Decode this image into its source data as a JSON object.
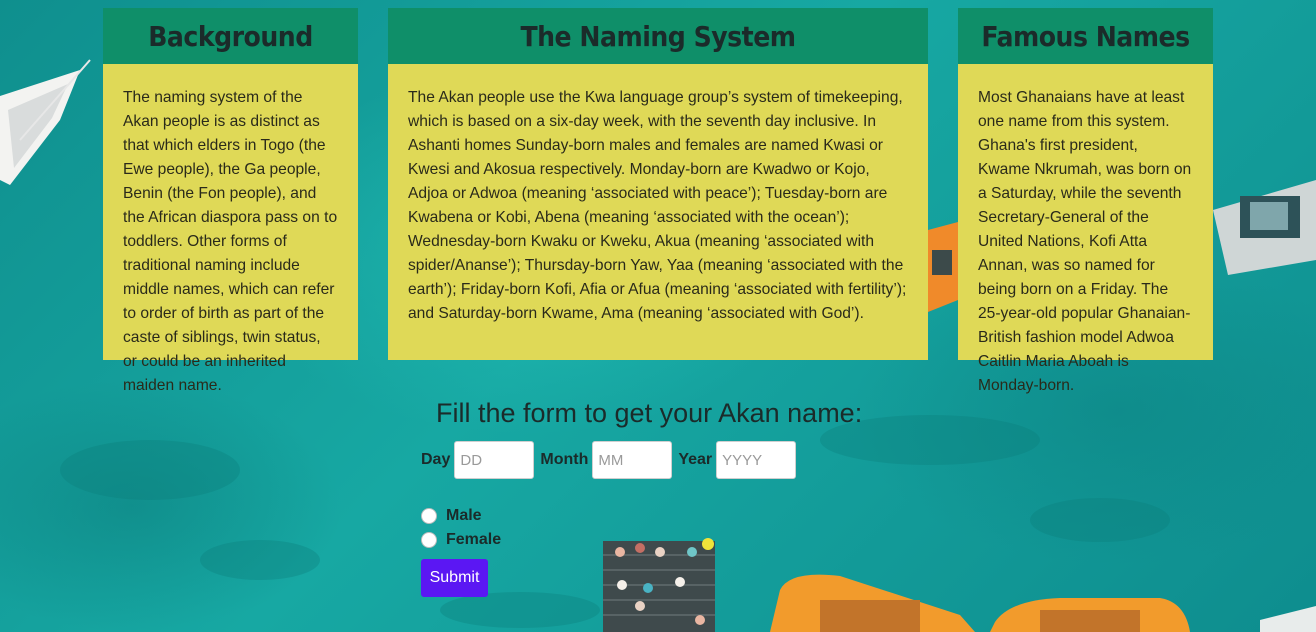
{
  "cards": [
    {
      "title": "Background",
      "body": "The naming system of the Akan people is as distinct as that which elders in Togo (the Ewe people), the Ga people, Benin (the Fon people), and the African diaspora pass on to toddlers. Other forms of traditional naming include middle names, which can refer to order of birth as part of the caste of siblings, twin status, or could be an inherited maiden name."
    },
    {
      "title": "The Naming System",
      "body": "The Akan people use the Kwa language group’s system of timekeeping, which is based on a six-day week, with the seventh day inclusive. In Ashanti homes Sunday-born males and females are named Kwasi or Kwesi and Akosua respectively. Monday-born are Kwadwo or Kojo, Adjoa or Adwoa (meaning ‘associated with peace’); Tuesday-born are Kwabena or Kobi, Abena (meaning ‘associated with the ocean’); Wednesday-born Kwaku or Kweku, Akua (meaning ‘associated with spider/Ananse’); Thursday-born Yaw, Yaa (meaning ‘associated with the earth’); Friday-born Kofi, Afia or Afua (meaning ‘associated with fertility’); and Saturday-born Kwame, Ama (meaning ‘associated with God’)."
    },
    {
      "title": "Famous Names",
      "body": "Most Ghanaians have at least one name from this system. Ghana's first president, Kwame Nkrumah, was born on a Saturday, while the seventh Secretary-General of the United Nations, Kofi Atta Annan, was so named for being born on a Friday. The 25-year-old popular Ghanaian-British fashion model Adwoa Caitlin Maria Aboah is Monday-born."
    }
  ],
  "form": {
    "title": "Fill the form to get your Akan name:",
    "day_label": "Day",
    "day_placeholder": "DD",
    "month_label": "Month",
    "month_placeholder": "MM",
    "year_label": "Year",
    "year_placeholder": "YYYY",
    "gender_options": [
      "Male",
      "Female"
    ],
    "submit_label": "Submit"
  },
  "colors": {
    "card_header": "#0f8f69",
    "card_body": "#dfd957",
    "submit_button": "#5b17f3",
    "background_sea": "#169f9c"
  }
}
